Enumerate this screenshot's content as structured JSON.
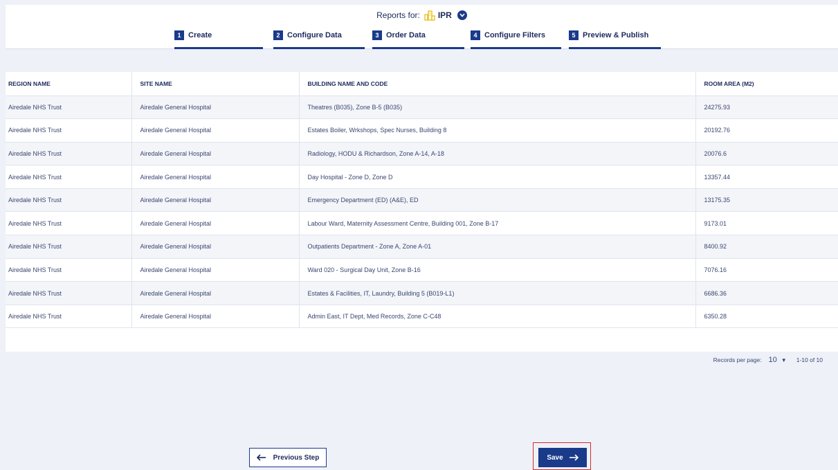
{
  "header": {
    "reports_for_label": "Reports for:",
    "selected_org": "IPR"
  },
  "steps": [
    {
      "num": "1",
      "label": "Create"
    },
    {
      "num": "2",
      "label": "Configure Data"
    },
    {
      "num": "3",
      "label": "Order Data"
    },
    {
      "num": "4",
      "label": "Configure Filters"
    },
    {
      "num": "5",
      "label": "Preview & Publish"
    }
  ],
  "table": {
    "columns": [
      "REGION NAME",
      "SITE NAME",
      "BUILDING NAME AND CODE",
      "ROOM AREA (M2)"
    ],
    "rows": [
      [
        "Airedale NHS Trust",
        "Airedale General Hospital",
        "Theatres (B035), Zone B-5 (B035)",
        "24275.93"
      ],
      [
        "Airedale NHS Trust",
        "Airedale General Hospital",
        "Estates Boiler, Wrkshops, Spec Nurses, Building 8",
        "20192.76"
      ],
      [
        "Airedale NHS Trust",
        "Airedale General Hospital",
        "Radiology, HODU & Richardson, Zone A-14, A-18",
        "20076.6"
      ],
      [
        "Airedale NHS Trust",
        "Airedale General Hospital",
        "Day Hospital - Zone D, Zone D",
        "13357.44"
      ],
      [
        "Airedale NHS Trust",
        "Airedale General Hospital",
        "Emergency Department (ED) (A&E), ED",
        "13175.35"
      ],
      [
        "Airedale NHS Trust",
        "Airedale General Hospital",
        "Labour Ward, Maternity Assessment Centre, Building 001, Zone B-17",
        "9173.01"
      ],
      [
        "Airedale NHS Trust",
        "Airedale General Hospital",
        "Outpatients Department - Zone A, Zone A-01",
        "8400.92"
      ],
      [
        "Airedale NHS Trust",
        "Airedale General Hospital",
        "Ward 020 - Surgical Day Unit, Zone B-16",
        "7076.16"
      ],
      [
        "Airedale NHS Trust",
        "Airedale General Hospital",
        "Estates & Facilities, IT, Laundry, Building 5 (B019-L1)",
        "6686.36"
      ],
      [
        "Airedale NHS Trust",
        "Airedale General Hospital",
        "Admin East, IT Dept, Med Records, Zone C-C48",
        "6350.28"
      ]
    ]
  },
  "pagination": {
    "records_per_page_label": "Records per page:",
    "records_per_page_value": "10",
    "range_text": "1-10 of 10"
  },
  "actions": {
    "previous_label": "Previous Step",
    "save_label": "Save"
  },
  "colors": {
    "primary": "#1a3a8a",
    "highlight_outline": "#d32a2a",
    "icon_yellow": "#e6b800"
  },
  "icons": {
    "org_icon": "buildings-icon",
    "dropdown": "chevron-down-icon",
    "prev_arrow": "arrow-left-icon",
    "save_arrow": "arrow-right-icon"
  }
}
